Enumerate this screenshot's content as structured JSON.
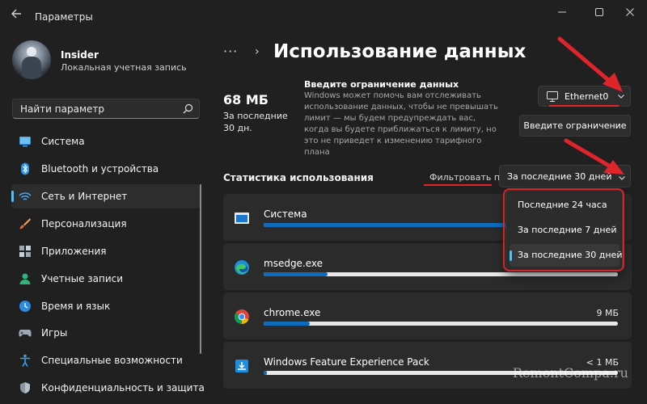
{
  "window": {
    "title": "Параметры",
    "controls": {
      "minimize": "minimize-icon",
      "maximize": "maximize-icon",
      "close": "close-icon"
    }
  },
  "sidebar": {
    "user_name": "Insider",
    "account_type": "Локальная учетная запись",
    "search_placeholder": "Найти параметр",
    "items": [
      {
        "label": "Система",
        "icon": "monitor-icon"
      },
      {
        "label": "Bluetooth и устройства",
        "icon": "bluetooth-icon"
      },
      {
        "label": "Сеть и Интернет",
        "icon": "wifi-icon",
        "active": true
      },
      {
        "label": "Персонализация",
        "icon": "brush-icon"
      },
      {
        "label": "Приложения",
        "icon": "apps-icon"
      },
      {
        "label": "Учетные записи",
        "icon": "person-icon"
      },
      {
        "label": "Время и язык",
        "icon": "globe-clock-icon"
      },
      {
        "label": "Игры",
        "icon": "gamepad-icon"
      },
      {
        "label": "Специальные возможности",
        "icon": "accessibility-icon"
      },
      {
        "label": "Конфиденциальность и защита",
        "icon": "shield-icon"
      }
    ]
  },
  "main": {
    "breadcrumb_more": "···",
    "title": "Использование данных",
    "usage_size": "68 МБ",
    "usage_period": "За последние 30 дн.",
    "limit_title": "Введите ограничение данных",
    "limit_description": "Windows может помочь вам отслеживать использование данных, чтобы не превышать лимит — мы будем предупреждать вас, когда вы будете приближаться к лимиту, но это не приведет к изменению тарифного плана",
    "network_adapter": "Ethernet0",
    "limit_button": "Введите ограничение",
    "stats_title": "Статистика использования",
    "filter_label": "Фильтровать по:",
    "filter_value": "За последние 30 дней",
    "filter_options": [
      "Последние 24 часа",
      "За последние 7 дней",
      "За последние 30 дней"
    ],
    "selected_filter_index": 2,
    "apps": [
      {
        "name": "Система",
        "size": "",
        "usage_fraction": 0.8,
        "icon": "system-window-icon"
      },
      {
        "name": "msedge.exe",
        "size": "",
        "usage_fraction": 0.18,
        "icon": "edge-icon"
      },
      {
        "name": "chrome.exe",
        "size": "9 МБ",
        "usage_fraction": 0.13,
        "icon": "chrome-icon"
      },
      {
        "name": "Windows Feature Experience Pack",
        "size": "< 1 МБ",
        "usage_fraction": 0.01,
        "icon": "feature-pack-icon"
      }
    ]
  },
  "colors": {
    "accent": "#4cc2ff",
    "progress": "#0f6cbd",
    "annotation_red": "#e0242b",
    "background": "#202020"
  },
  "watermark": "RemontCompa.ru"
}
